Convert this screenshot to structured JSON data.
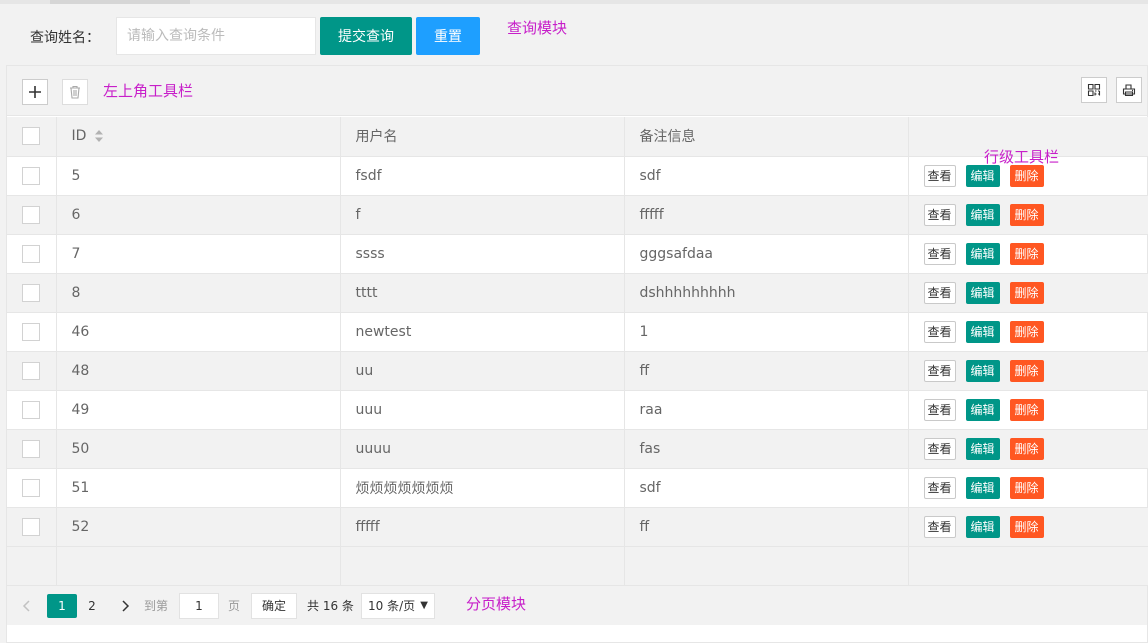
{
  "search": {
    "label": "查询姓名：",
    "placeholder": "请输入查询条件",
    "submit_label": "提交查询",
    "reset_label": "重置"
  },
  "annotations": {
    "query_module": "查询模块",
    "top_left_toolbar": "左上角工具栏",
    "row_toolbar": "行级工具栏",
    "pagination_module": "分页模块"
  },
  "toolbar": {
    "add_icon": "plus-icon",
    "delete_icon": "trash-icon",
    "columns_icon": "grid-icon",
    "print_icon": "print-icon"
  },
  "table": {
    "columns": [
      "ID",
      "用户名",
      "备注信息"
    ],
    "rows": [
      {
        "id": "5",
        "username": "fsdf",
        "remark": "sdf"
      },
      {
        "id": "6",
        "username": "f",
        "remark": "fffff"
      },
      {
        "id": "7",
        "username": "ssss",
        "remark": "gggsafdaa"
      },
      {
        "id": "8",
        "username": "tttt",
        "remark": "dshhhhhhhhh"
      },
      {
        "id": "46",
        "username": "newtest",
        "remark": "1"
      },
      {
        "id": "48",
        "username": "uu",
        "remark": "ff"
      },
      {
        "id": "49",
        "username": "uuu",
        "remark": "raa"
      },
      {
        "id": "50",
        "username": "uuuu",
        "remark": "fas"
      },
      {
        "id": "51",
        "username": "烦烦烦烦烦烦烦",
        "remark": "sdf"
      },
      {
        "id": "52",
        "username": "fffff",
        "remark": "ff"
      }
    ],
    "actions": {
      "view": "查看",
      "edit": "编辑",
      "delete": "删除"
    }
  },
  "pagination": {
    "current_page": "1",
    "next_page": "2",
    "goto_prefix": "到第",
    "goto_value": "1",
    "goto_suffix": "页",
    "confirm": "确定",
    "total": "共 16 条",
    "page_size": "10 条/页"
  },
  "colors": {
    "primary": "#009688",
    "normal": "#1E9FFF",
    "danger": "#FF5722",
    "annotation": "#c71fc9"
  }
}
